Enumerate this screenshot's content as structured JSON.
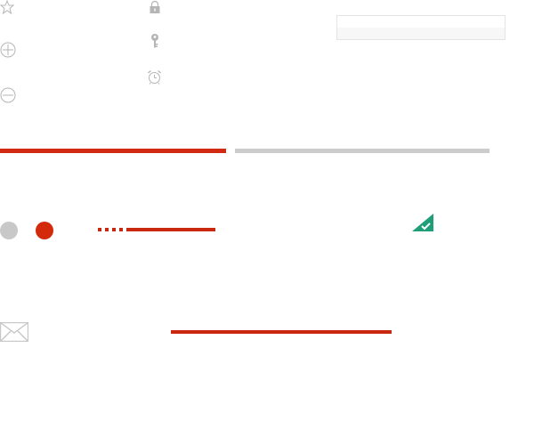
{
  "progress": {
    "fraction": 0.46
  },
  "colors": {
    "accent_red": "#d22a12",
    "track_gray": "#cccccc",
    "success_green": "#1f9e77",
    "icon_gray": "#b5b5b5"
  },
  "icons": {
    "star": "star-icon",
    "add": "add-circle-icon",
    "remove": "remove-circle-icon",
    "lock": "lock-icon",
    "key": "key-icon",
    "alarm": "alarm-clock-icon",
    "check": "check-badge-icon",
    "mail": "mail-icon"
  }
}
